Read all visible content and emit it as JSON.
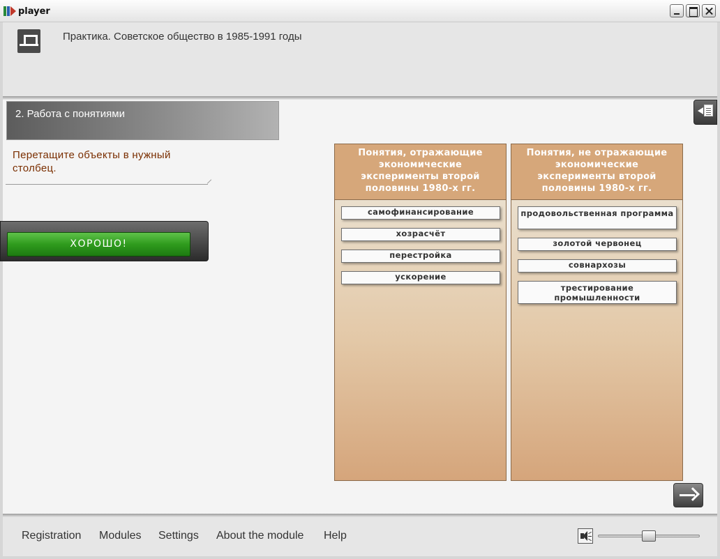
{
  "window": {
    "title": "player"
  },
  "header": {
    "logo_icon": "app-logo-icon",
    "title": "Практика. Советское общество в 1985-1991 годы"
  },
  "section": {
    "title": "2. Работа с понятиями"
  },
  "task": {
    "instruction": "Перетащите объекты в нужный столбец."
  },
  "feedback": {
    "label": "ХОРОШО!",
    "color": "#2f9b1d"
  },
  "columns": [
    {
      "header": "Понятия, отражающие экономические эксперименты второй половины 1980-х гг.",
      "items": [
        "самофинансирование",
        "хозрасчёт",
        "перестройка",
        "ускорение"
      ]
    },
    {
      "header": "Понятия, не отражающие экономические эксперименты второй половины 1980-х гг.",
      "items": [
        "продовольственная программа",
        "золотой червонец",
        "совнархозы",
        "трестирование промышленности"
      ]
    }
  ],
  "footer": {
    "menu": [
      "Registration",
      "Modules",
      "Settings",
      "About the module",
      "Help"
    ],
    "volume_level": 0.5
  },
  "colors": {
    "column_header": "#d6a77a",
    "instruction_text": "#7a2e00"
  }
}
